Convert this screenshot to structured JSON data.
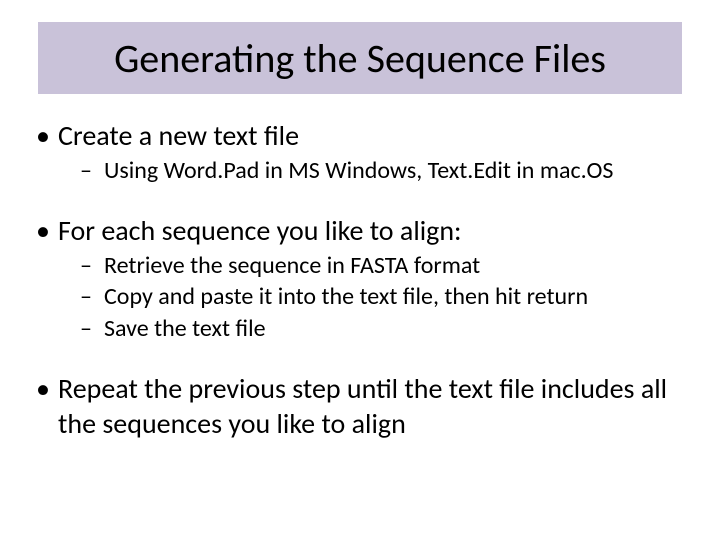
{
  "title": "Generating the Sequence Files",
  "bullets": {
    "b1": "Create a new text file",
    "b1_sub1": "Using Word.Pad in MS Windows, Text.Edit in mac.OS",
    "b2": "For each sequence you like to align:",
    "b2_sub1": "Retrieve the sequence in FASTA format",
    "b2_sub2": "Copy and paste it into the text file, then hit return",
    "b2_sub3": "Save the text file",
    "b3": "Repeat the previous step until the text file includes all the sequences you like to align"
  }
}
